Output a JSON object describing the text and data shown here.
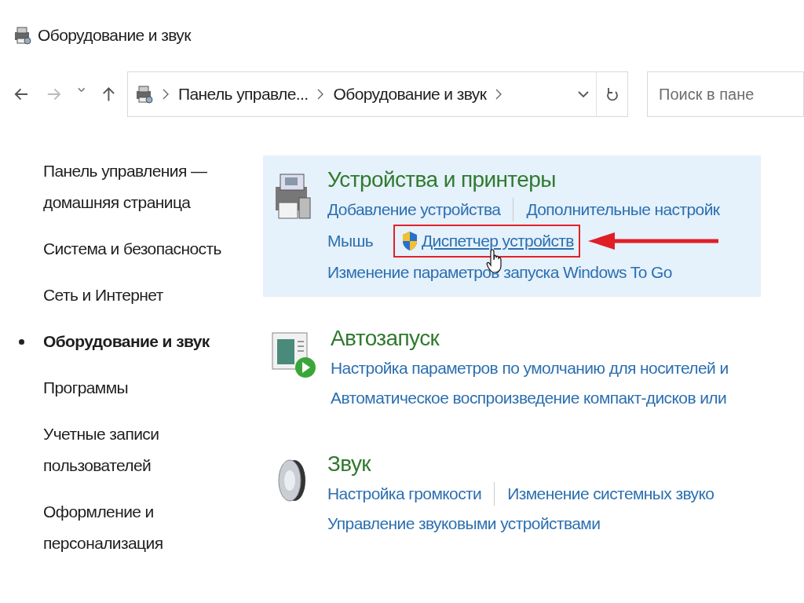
{
  "window": {
    "title": "Оборудование и звук"
  },
  "address_bar": {
    "crumbs": [
      "Панель управле...",
      "Оборудование и звук"
    ]
  },
  "search": {
    "placeholder": "Поиск в пане"
  },
  "sidebar": {
    "items": [
      {
        "label": "Панель управления — домашняя страница",
        "selected": false
      },
      {
        "label": "Система и безопасность",
        "selected": false
      },
      {
        "label": "Сеть и Интернет",
        "selected": false
      },
      {
        "label": "Оборудование и звук",
        "selected": true
      },
      {
        "label": "Программы",
        "selected": false
      },
      {
        "label": "Учетные записи пользователей",
        "selected": false
      },
      {
        "label": "Оформление и персонализация",
        "selected": false
      }
    ]
  },
  "sections": [
    {
      "title": "Устройства и принтеры",
      "kind": "printer",
      "highlighted": true,
      "rows": [
        [
          {
            "text": "Добавление устройства"
          },
          {
            "text": "Дополнительные настройк"
          }
        ],
        [
          {
            "text": "Мышь"
          },
          {
            "text": "Диспетчер устройств",
            "shield": true,
            "hovered": true,
            "framed": true
          }
        ],
        [
          {
            "text": "Изменение параметров запуска Windows To Go"
          }
        ]
      ]
    },
    {
      "title": "Автозапуск",
      "kind": "autoplay",
      "highlighted": false,
      "rows": [
        [
          {
            "text": "Настройка параметров по умолчанию для носителей и"
          }
        ],
        [
          {
            "text": "Автоматическое воспроизведение компакт-дисков или"
          }
        ]
      ]
    },
    {
      "title": "Звук",
      "kind": "speaker",
      "highlighted": false,
      "rows": [
        [
          {
            "text": "Настройка громкости"
          },
          {
            "text": "Изменение системных звуко"
          }
        ],
        [
          {
            "text": "Управление звуковыми устройствами"
          }
        ]
      ]
    }
  ]
}
